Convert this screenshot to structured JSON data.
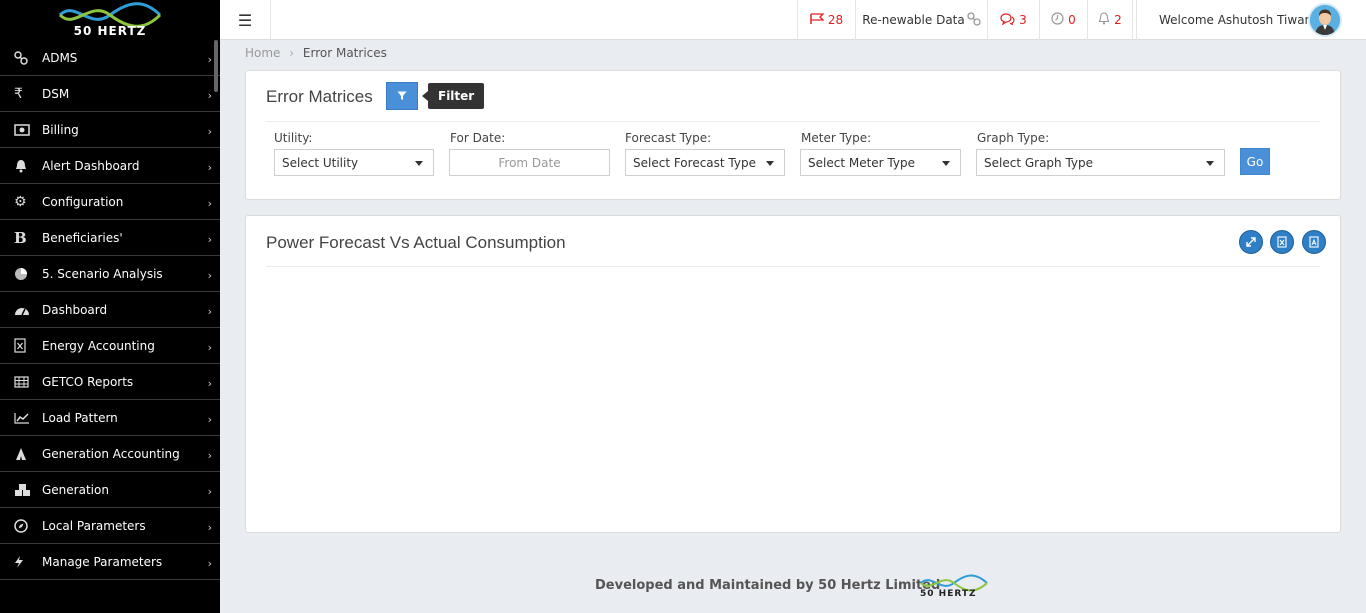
{
  "sidebar": {
    "logo_text": "50 HERTZ",
    "items": [
      {
        "label": "ADMS",
        "icon": "link-icon"
      },
      {
        "label": "DSM",
        "icon": "rupee-icon"
      },
      {
        "label": "Billing",
        "icon": "money-icon"
      },
      {
        "label": "Alert Dashboard",
        "icon": "bell-icon"
      },
      {
        "label": "Configuration",
        "icon": "gear-icon"
      },
      {
        "label": "Beneficiaries'",
        "icon": "b-letter-icon"
      },
      {
        "label": "5. Scenario Analysis",
        "icon": "pie-chart-icon"
      },
      {
        "label": "Dashboard",
        "icon": "dashboard-icon"
      },
      {
        "label": "Energy Accounting",
        "icon": "excel-file-icon"
      },
      {
        "label": "GETCO Reports",
        "icon": "table-icon"
      },
      {
        "label": "Load Pattern",
        "icon": "line-chart-icon"
      },
      {
        "label": "Generation Accounting",
        "icon": "tower-icon"
      },
      {
        "label": "Generation",
        "icon": "cubes-icon"
      },
      {
        "label": "Local Parameters",
        "icon": "compass-icon"
      },
      {
        "label": "Manage Parameters",
        "icon": "bolt-icon"
      }
    ]
  },
  "topbar": {
    "flags_count": "28",
    "renewable_label": "Re-newable Data",
    "messages_count": "3",
    "clock_count": "0",
    "bell_count": "2",
    "welcome": "Welcome Ashutosh Tiwari"
  },
  "breadcrumb": {
    "home": "Home",
    "sep": "›",
    "current": "Error Matrices"
  },
  "filters_panel": {
    "title": "Error Matrices",
    "filter_tooltip": "Filter",
    "utility_label": "Utility:",
    "utility_value": "Select Utility",
    "date_label": "For Date:",
    "date_placeholder": "From Date",
    "forecast_label": "Forecast Type:",
    "forecast_value": "Select Forecast Type",
    "meter_label": "Meter Type:",
    "meter_value": "Select Meter Type",
    "graph_label": "Graph Type:",
    "graph_value": "Select Graph Type",
    "go_label": "Go"
  },
  "chart_panel": {
    "title": "Power Forecast Vs Actual Consumption"
  },
  "footer": {
    "text": "Developed and Maintained by 50 Hertz Limited",
    "logo_text": "50 HERTZ"
  },
  "colors": {
    "sidebar_bg": "#000000",
    "accent_blue": "#4a90d9",
    "alert_red": "#e02020",
    "page_bg": "#e9ecf0"
  }
}
